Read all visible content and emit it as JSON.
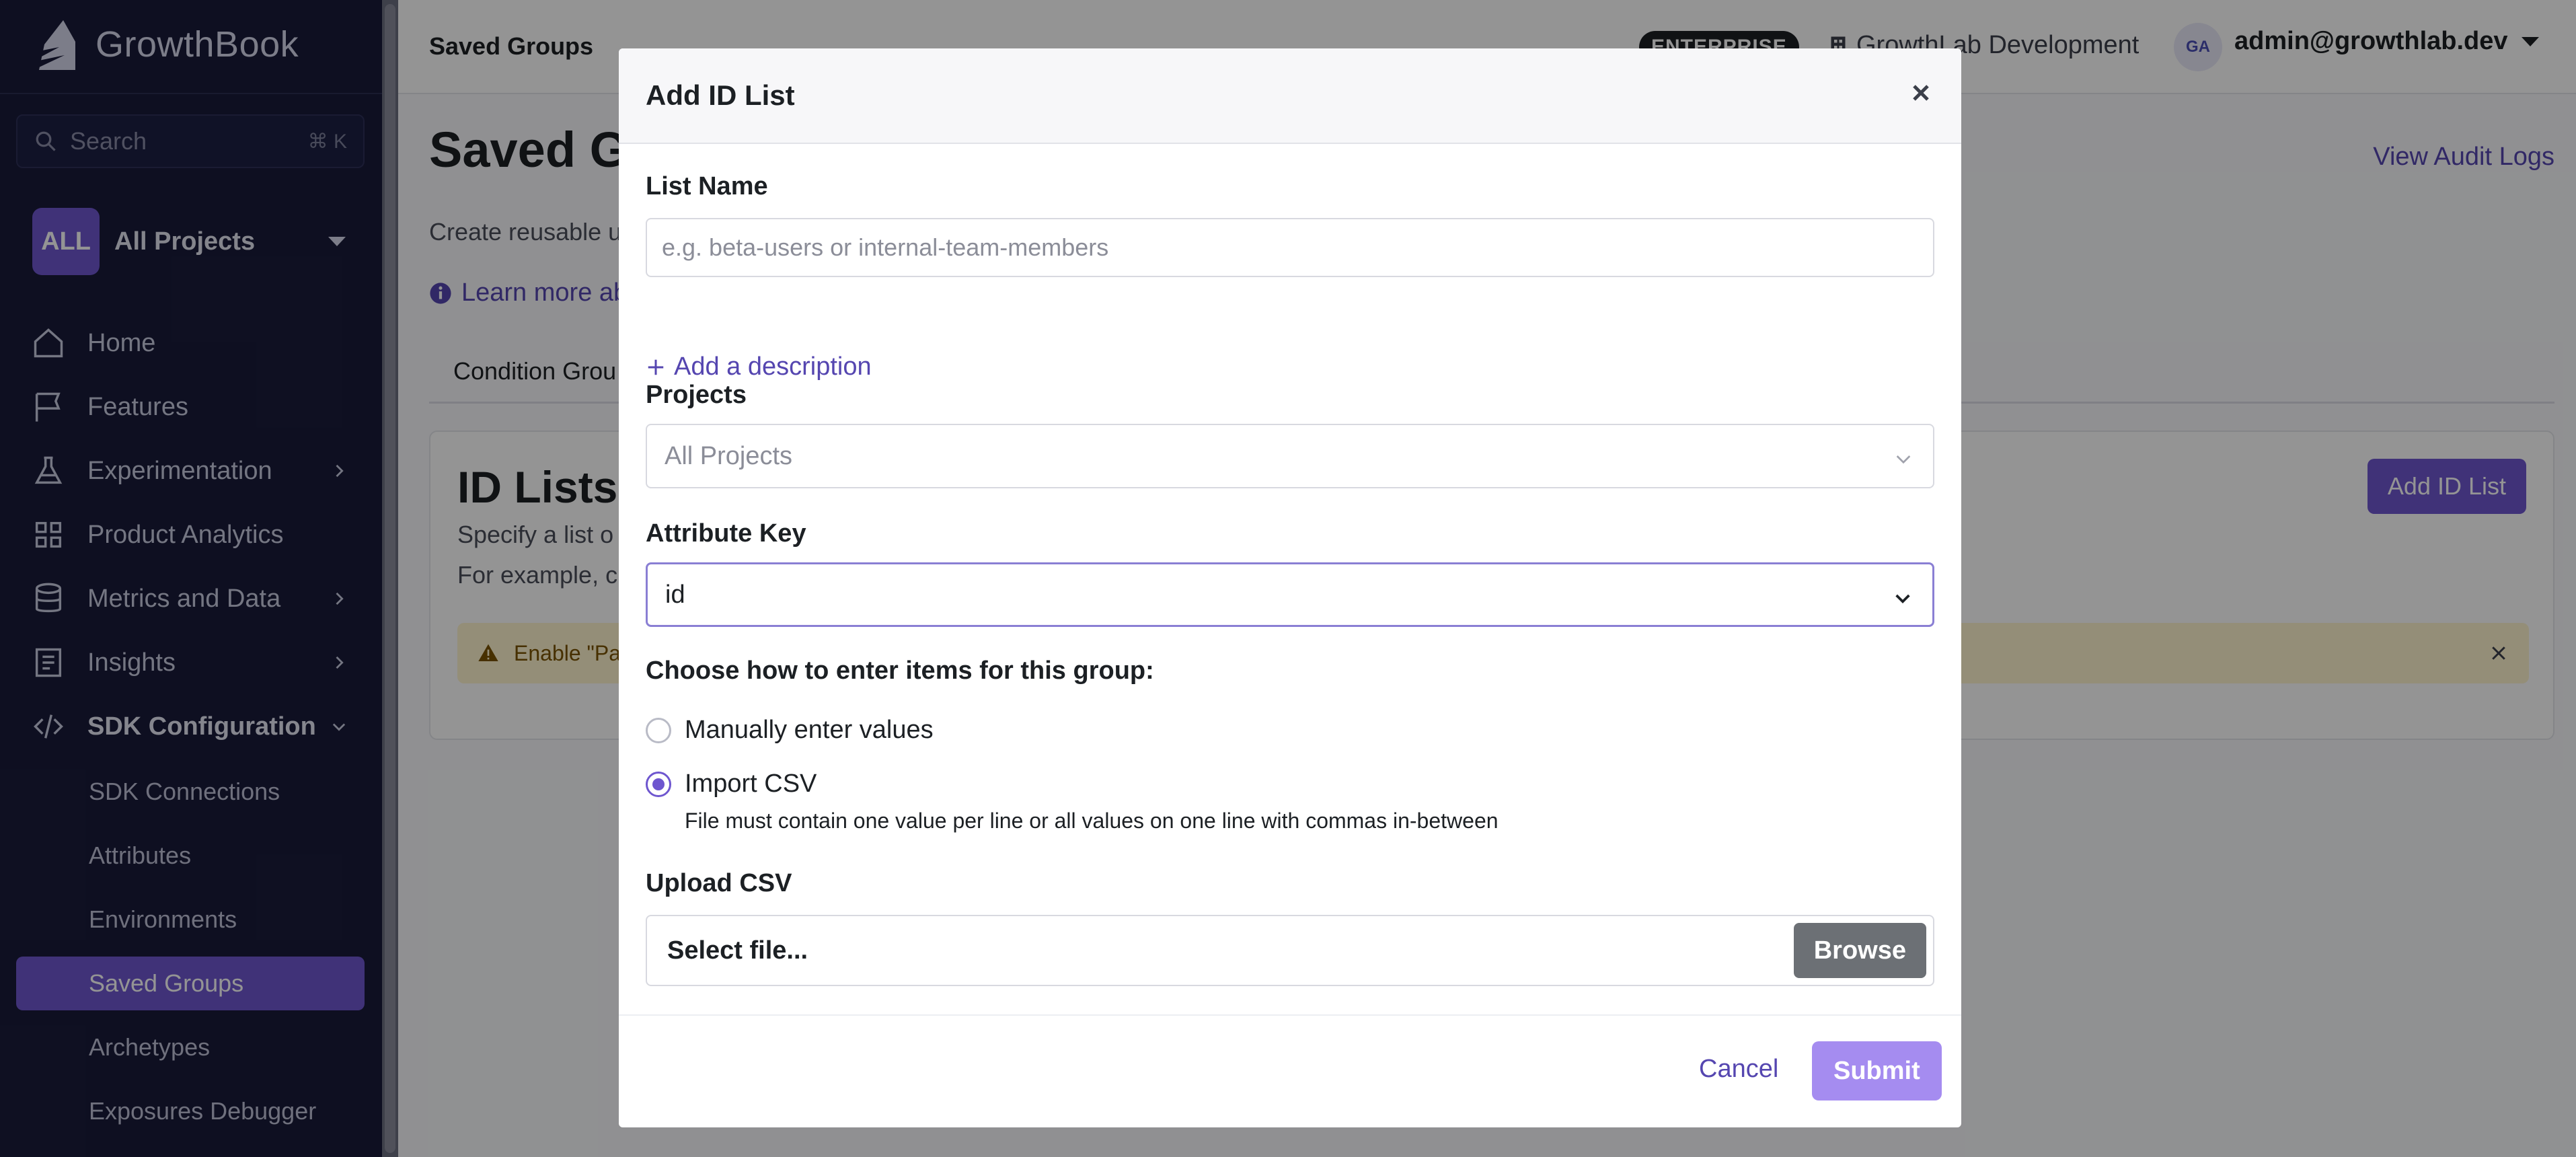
{
  "sidebar": {
    "brand": "GrowthBook",
    "search": {
      "placeholder": "Search",
      "shortcut": "⌘ K"
    },
    "project": {
      "badge": "ALL",
      "label": "All Projects"
    },
    "items": [
      {
        "label": "Home",
        "icon": "home-icon"
      },
      {
        "label": "Features",
        "icon": "flag-icon"
      },
      {
        "label": "Experimentation",
        "icon": "flask-icon"
      },
      {
        "label": "Product Analytics",
        "icon": "grid-icon"
      },
      {
        "label": "Metrics and Data",
        "icon": "database-icon"
      },
      {
        "label": "Insights",
        "icon": "document-icon"
      },
      {
        "label": "SDK Configuration",
        "icon": "code-icon"
      }
    ],
    "sub_items": [
      "SDK Connections",
      "Attributes",
      "Environments",
      "Saved Groups",
      "Archetypes",
      "Exposures Debugger"
    ],
    "active_sub": "Saved Groups"
  },
  "header": {
    "breadcrumb": "Saved Groups",
    "plan_badge": "ENTERPRISE",
    "org": "GrowthLab Development",
    "avatar": "GA",
    "user": "admin@growthlab.dev"
  },
  "page": {
    "title": "Saved Gr",
    "description": "Create reusable u",
    "learn_more": "Learn more ab",
    "audit_link": "View Audit Logs",
    "tab": "Condition Grou",
    "card": {
      "title": "ID Lists",
      "desc1": "Specify a list o",
      "desc2": "For example, c",
      "add_button": "Add ID List",
      "warning": "Enable \"Pa"
    }
  },
  "modal": {
    "title": "Add ID List",
    "list_name_label": "List Name",
    "list_name_placeholder": "e.g. beta-users or internal-team-members",
    "add_description": "Add a description",
    "projects_label": "Projects",
    "projects_value": "All Projects",
    "attribute_key_label": "Attribute Key",
    "attribute_key_value": "id",
    "choose_label": "Choose how to enter items for this group:",
    "option_manual": "Manually enter values",
    "option_import": "Import CSV",
    "selected_option": "Import CSV",
    "import_help": "File must contain one value per line or all values on one line with commas in-between",
    "upload_label": "Upload CSV",
    "file_placeholder": "Select file...",
    "browse": "Browse",
    "cancel": "Cancel",
    "submit": "Submit"
  },
  "colors": {
    "sidebar_bg": "#191b3a",
    "accent": "#6e56cf",
    "submit_disabled": "#a58cf0",
    "link": "#5546b0"
  }
}
